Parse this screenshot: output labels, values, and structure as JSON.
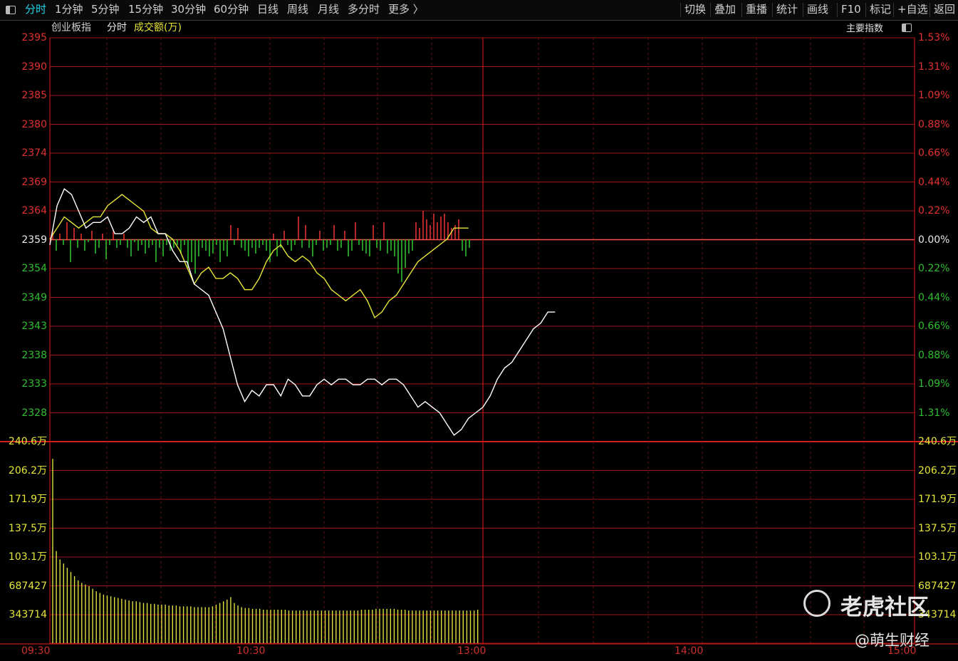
{
  "toolbar": {
    "tabs": [
      "分时",
      "1分钟",
      "5分钟",
      "15分钟",
      "30分钟",
      "60分钟",
      "日线",
      "周线",
      "月线",
      "多分时",
      "更多 〉"
    ],
    "active_tab": "分时",
    "right": [
      "切换",
      "叠加",
      "重播",
      "统计",
      "画线",
      "F10",
      "标记",
      "+自选",
      "返回"
    ]
  },
  "header": {
    "index_name": "创业板指",
    "mode": "分时",
    "volume_label": "成交额(万)",
    "indicator_button": "主要指数"
  },
  "colors": {
    "up": "#e03131",
    "down": "#2fbf2f",
    "price_line": "#ffffff",
    "avg_line": "#e6e63a",
    "grid": "#a01818"
  },
  "chart_data": {
    "type": "line",
    "price_axis_left": [
      "2395",
      "2390",
      "2385",
      "2380",
      "2374",
      "2369",
      "2364",
      "2359",
      "2354",
      "2349",
      "2343",
      "2338",
      "2333",
      "2328"
    ],
    "price_axis_right": [
      "1.53%",
      "1.31%",
      "1.09%",
      "0.88%",
      "0.66%",
      "0.44%",
      "0.22%",
      "0.00%",
      "0.22%",
      "0.44%",
      "0.66%",
      "0.88%",
      "1.09%",
      "1.31%"
    ],
    "prev_close": 2359,
    "volume_axis": [
      "240.6万",
      "206.2万",
      "171.9万",
      "137.5万",
      "103.1万",
      "687427",
      "343714"
    ],
    "time_labels": [
      "09:30",
      "10:30",
      "13:00",
      "14:00",
      "15:00"
    ],
    "price_series": [
      [
        0,
        2358
      ],
      [
        2,
        2365
      ],
      [
        4,
        2368
      ],
      [
        6,
        2367
      ],
      [
        8,
        2364
      ],
      [
        10,
        2361
      ],
      [
        12,
        2362
      ],
      [
        14,
        2362
      ],
      [
        16,
        2363
      ],
      [
        18,
        2360
      ],
      [
        20,
        2360
      ],
      [
        22,
        2361
      ],
      [
        24,
        2363
      ],
      [
        26,
        2362
      ],
      [
        28,
        2363
      ],
      [
        30,
        2360
      ],
      [
        32,
        2360
      ],
      [
        34,
        2357
      ],
      [
        36,
        2355
      ],
      [
        38,
        2355
      ],
      [
        40,
        2351
      ],
      [
        42,
        2350
      ],
      [
        44,
        2349
      ],
      [
        46,
        2346
      ],
      [
        48,
        2343
      ],
      [
        50,
        2338
      ],
      [
        52,
        2333
      ],
      [
        54,
        2330
      ],
      [
        56,
        2332
      ],
      [
        58,
        2331
      ],
      [
        60,
        2333
      ],
      [
        62,
        2333
      ],
      [
        64,
        2331
      ],
      [
        66,
        2334
      ],
      [
        68,
        2333
      ],
      [
        70,
        2331
      ],
      [
        72,
        2331
      ],
      [
        74,
        2333
      ],
      [
        76,
        2334
      ],
      [
        78,
        2333
      ],
      [
        80,
        2334
      ],
      [
        82,
        2334
      ],
      [
        84,
        2333
      ],
      [
        86,
        2333
      ],
      [
        88,
        2334
      ],
      [
        90,
        2334
      ],
      [
        92,
        2333
      ],
      [
        94,
        2334
      ],
      [
        96,
        2334
      ],
      [
        98,
        2333
      ],
      [
        100,
        2331
      ],
      [
        102,
        2329
      ],
      [
        104,
        2330
      ],
      [
        106,
        2329
      ],
      [
        108,
        2328
      ],
      [
        110,
        2326
      ],
      [
        112,
        2324
      ],
      [
        114,
        2325
      ],
      [
        116,
        2327
      ],
      [
        118,
        2328
      ],
      [
        120,
        2329
      ],
      [
        122,
        2331
      ],
      [
        124,
        2334
      ],
      [
        126,
        2336
      ],
      [
        128,
        2337
      ],
      [
        130,
        2339
      ],
      [
        132,
        2341
      ],
      [
        134,
        2343
      ],
      [
        136,
        2344
      ],
      [
        138,
        2346
      ],
      [
        140,
        2346
      ]
    ],
    "avg_series": [
      [
        0,
        2359
      ],
      [
        2,
        2361
      ],
      [
        4,
        2363
      ],
      [
        6,
        2362
      ],
      [
        8,
        2361
      ],
      [
        10,
        2362
      ],
      [
        12,
        2363
      ],
      [
        14,
        2363
      ],
      [
        16,
        2365
      ],
      [
        18,
        2366
      ],
      [
        20,
        2367
      ],
      [
        22,
        2366
      ],
      [
        24,
        2365
      ],
      [
        26,
        2364
      ],
      [
        28,
        2361
      ],
      [
        30,
        2360
      ],
      [
        32,
        2360
      ],
      [
        34,
        2359
      ],
      [
        36,
        2357
      ],
      [
        38,
        2354
      ],
      [
        40,
        2351
      ],
      [
        42,
        2353
      ],
      [
        44,
        2354
      ],
      [
        46,
        2352
      ],
      [
        48,
        2352
      ],
      [
        50,
        2353
      ],
      [
        52,
        2352
      ],
      [
        54,
        2350
      ],
      [
        56,
        2350
      ],
      [
        58,
        2352
      ],
      [
        60,
        2355
      ],
      [
        62,
        2357
      ],
      [
        64,
        2358
      ],
      [
        66,
        2356
      ],
      [
        68,
        2355
      ],
      [
        70,
        2356
      ],
      [
        72,
        2355
      ],
      [
        74,
        2353
      ],
      [
        76,
        2352
      ],
      [
        78,
        2350
      ],
      [
        80,
        2349
      ],
      [
        82,
        2348
      ],
      [
        84,
        2349
      ],
      [
        86,
        2350
      ],
      [
        88,
        2348
      ],
      [
        90,
        2345
      ],
      [
        92,
        2346
      ],
      [
        94,
        2348
      ],
      [
        96,
        2349
      ],
      [
        98,
        2351
      ],
      [
        100,
        2353
      ],
      [
        102,
        2355
      ],
      [
        104,
        2356
      ],
      [
        106,
        2357
      ],
      [
        108,
        2358
      ],
      [
        110,
        2359
      ],
      [
        112,
        2361
      ],
      [
        114,
        2361
      ],
      [
        116,
        2361
      ]
    ],
    "volume_bars": [
      [
        0,
        2.2
      ],
      [
        1,
        1.1
      ],
      [
        2,
        1.0
      ],
      [
        3,
        0.95
      ],
      [
        4,
        0.9
      ],
      [
        5,
        0.85
      ],
      [
        6,
        0.8
      ],
      [
        7,
        0.75
      ],
      [
        8,
        0.72
      ],
      [
        9,
        0.7
      ],
      [
        10,
        0.68
      ],
      [
        11,
        0.65
      ],
      [
        12,
        0.62
      ],
      [
        13,
        0.6
      ],
      [
        14,
        0.58
      ],
      [
        15,
        0.57
      ],
      [
        16,
        0.56
      ],
      [
        17,
        0.55
      ],
      [
        18,
        0.54
      ],
      [
        19,
        0.53
      ],
      [
        20,
        0.52
      ],
      [
        21,
        0.51
      ],
      [
        22,
        0.5
      ],
      [
        23,
        0.5
      ],
      [
        24,
        0.49
      ],
      [
        25,
        0.48
      ],
      [
        26,
        0.48
      ],
      [
        27,
        0.47
      ],
      [
        28,
        0.47
      ],
      [
        29,
        0.46
      ],
      [
        30,
        0.46
      ],
      [
        31,
        0.46
      ],
      [
        32,
        0.45
      ],
      [
        33,
        0.45
      ],
      [
        34,
        0.45
      ],
      [
        35,
        0.44
      ],
      [
        36,
        0.44
      ],
      [
        37,
        0.44
      ],
      [
        38,
        0.44
      ],
      [
        39,
        0.43
      ],
      [
        40,
        0.43
      ],
      [
        41,
        0.43
      ],
      [
        42,
        0.43
      ],
      [
        43,
        0.43
      ],
      [
        44,
        0.44
      ],
      [
        45,
        0.46
      ],
      [
        46,
        0.48
      ],
      [
        47,
        0.5
      ],
      [
        48,
        0.52
      ],
      [
        49,
        0.55
      ],
      [
        50,
        0.48
      ],
      [
        51,
        0.45
      ],
      [
        52,
        0.43
      ],
      [
        53,
        0.42
      ],
      [
        54,
        0.42
      ],
      [
        55,
        0.41
      ],
      [
        56,
        0.41
      ],
      [
        57,
        0.41
      ],
      [
        58,
        0.4
      ],
      [
        59,
        0.4
      ],
      [
        60,
        0.4
      ],
      [
        61,
        0.4
      ],
      [
        62,
        0.4
      ],
      [
        63,
        0.4
      ],
      [
        64,
        0.4
      ],
      [
        65,
        0.39
      ],
      [
        66,
        0.39
      ],
      [
        67,
        0.39
      ],
      [
        68,
        0.39
      ],
      [
        69,
        0.39
      ],
      [
        70,
        0.39
      ],
      [
        71,
        0.39
      ],
      [
        72,
        0.39
      ],
      [
        73,
        0.39
      ],
      [
        74,
        0.39
      ],
      [
        75,
        0.39
      ],
      [
        76,
        0.39
      ],
      [
        77,
        0.39
      ],
      [
        78,
        0.39
      ],
      [
        79,
        0.39
      ],
      [
        80,
        0.39
      ],
      [
        81,
        0.39
      ],
      [
        82,
        0.39
      ],
      [
        83,
        0.39
      ],
      [
        84,
        0.39
      ],
      [
        85,
        0.4
      ],
      [
        86,
        0.4
      ],
      [
        87,
        0.4
      ],
      [
        88,
        0.4
      ],
      [
        89,
        0.41
      ],
      [
        90,
        0.41
      ],
      [
        91,
        0.41
      ],
      [
        92,
        0.41
      ],
      [
        93,
        0.41
      ],
      [
        94,
        0.41
      ],
      [
        95,
        0.4
      ],
      [
        96,
        0.4
      ],
      [
        97,
        0.4
      ],
      [
        98,
        0.39
      ],
      [
        99,
        0.39
      ],
      [
        100,
        0.39
      ],
      [
        101,
        0.39
      ],
      [
        102,
        0.39
      ],
      [
        103,
        0.39
      ],
      [
        104,
        0.39
      ],
      [
        105,
        0.39
      ],
      [
        106,
        0.39
      ],
      [
        107,
        0.39
      ],
      [
        108,
        0.39
      ],
      [
        109,
        0.39
      ],
      [
        110,
        0.39
      ],
      [
        111,
        0.39
      ],
      [
        112,
        0.39
      ],
      [
        113,
        0.39
      ],
      [
        114,
        0.39
      ],
      [
        115,
        0.39
      ],
      [
        116,
        0.39
      ],
      [
        117,
        0.4
      ]
    ],
    "breadth_bars": [
      [
        0,
        3
      ],
      [
        1,
        -4
      ],
      [
        2,
        2
      ],
      [
        3,
        -2
      ],
      [
        4,
        6
      ],
      [
        5,
        -8
      ],
      [
        6,
        4
      ],
      [
        7,
        -3
      ],
      [
        8,
        2
      ],
      [
        9,
        -4
      ],
      [
        10,
        -1
      ],
      [
        11,
        3
      ],
      [
        12,
        -5
      ],
      [
        13,
        -3
      ],
      [
        14,
        2
      ],
      [
        15,
        -7
      ],
      [
        16,
        -2
      ],
      [
        17,
        3
      ],
      [
        18,
        -3
      ],
      [
        19,
        -2
      ],
      [
        20,
        2
      ],
      [
        21,
        -3
      ],
      [
        22,
        -6
      ],
      [
        23,
        -1
      ],
      [
        24,
        -4
      ],
      [
        25,
        -2
      ],
      [
        26,
        -5
      ],
      [
        27,
        -3
      ],
      [
        28,
        -2
      ],
      [
        29,
        -8
      ],
      [
        30,
        -3
      ],
      [
        31,
        -6
      ],
      [
        32,
        -2
      ],
      [
        33,
        -4
      ],
      [
        34,
        -3
      ],
      [
        35,
        -2
      ],
      [
        36,
        -5
      ],
      [
        37,
        -2
      ],
      [
        38,
        -10
      ],
      [
        39,
        -8
      ],
      [
        40,
        -12
      ],
      [
        41,
        -6
      ],
      [
        42,
        -3
      ],
      [
        43,
        -4
      ],
      [
        44,
        -6
      ],
      [
        45,
        -5
      ],
      [
        46,
        -2
      ],
      [
        47,
        -8
      ],
      [
        48,
        -4
      ],
      [
        49,
        -6
      ],
      [
        50,
        5
      ],
      [
        51,
        -2
      ],
      [
        52,
        4
      ],
      [
        53,
        -3
      ],
      [
        54,
        -4
      ],
      [
        55,
        -6
      ],
      [
        56,
        -3
      ],
      [
        57,
        -5
      ],
      [
        58,
        -3
      ],
      [
        59,
        -2
      ],
      [
        60,
        -4
      ],
      [
        61,
        -8
      ],
      [
        62,
        2
      ],
      [
        63,
        -6
      ],
      [
        64,
        -3
      ],
      [
        65,
        3
      ],
      [
        66,
        -2
      ],
      [
        67,
        -4
      ],
      [
        68,
        -2
      ],
      [
        69,
        8
      ],
      [
        70,
        -3
      ],
      [
        71,
        5
      ],
      [
        72,
        -3
      ],
      [
        73,
        -6
      ],
      [
        74,
        -2
      ],
      [
        75,
        3
      ],
      [
        76,
        -4
      ],
      [
        77,
        -3
      ],
      [
        78,
        -2
      ],
      [
        79,
        5
      ],
      [
        80,
        -4
      ],
      [
        81,
        -3
      ],
      [
        82,
        3
      ],
      [
        83,
        -6
      ],
      [
        84,
        -4
      ],
      [
        85,
        6
      ],
      [
        86,
        -2
      ],
      [
        87,
        -4
      ],
      [
        88,
        -5
      ],
      [
        89,
        -6
      ],
      [
        90,
        5
      ],
      [
        91,
        -3
      ],
      [
        92,
        -4
      ],
      [
        93,
        6
      ],
      [
        94,
        -5
      ],
      [
        95,
        -4
      ],
      [
        96,
        -6
      ],
      [
        97,
        -12
      ],
      [
        98,
        -15
      ],
      [
        99,
        -10
      ],
      [
        100,
        -5
      ],
      [
        101,
        -4
      ],
      [
        102,
        6
      ],
      [
        103,
        4
      ],
      [
        104,
        10
      ],
      [
        105,
        7
      ],
      [
        106,
        5
      ],
      [
        107,
        9
      ],
      [
        108,
        6
      ],
      [
        109,
        8
      ],
      [
        110,
        9
      ],
      [
        111,
        6
      ],
      [
        112,
        4
      ],
      [
        113,
        5
      ],
      [
        114,
        7
      ],
      [
        115,
        -4
      ],
      [
        116,
        -6
      ],
      [
        117,
        -3
      ]
    ]
  },
  "watermark": {
    "logo_text": "老虎社区",
    "author": "@萌生财经"
  }
}
